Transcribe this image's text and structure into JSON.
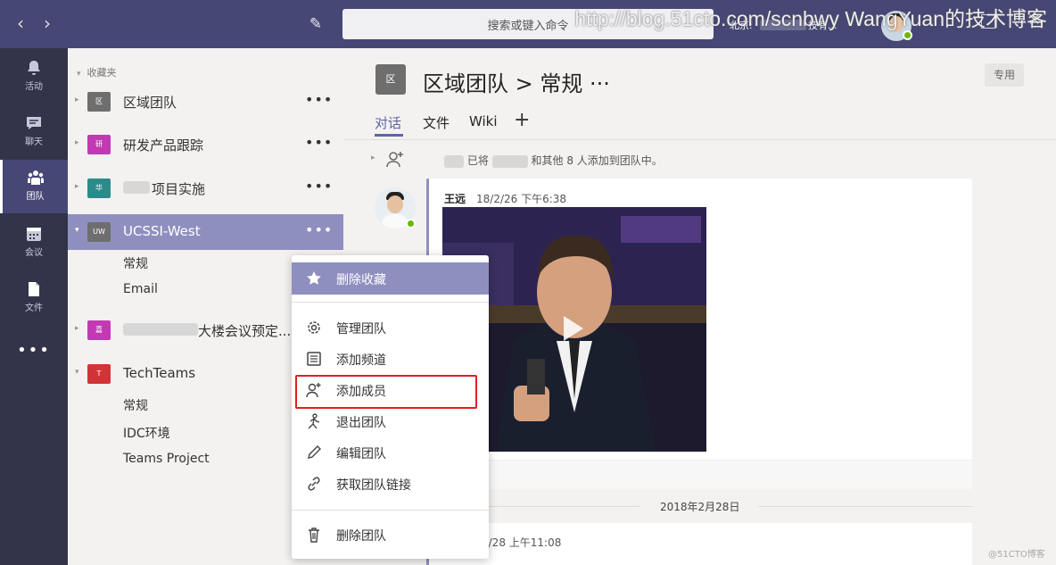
{
  "topbar": {
    "search_placeholder": "搜索或键入命令",
    "location": "北京:",
    "org": "技有...",
    "watermark": "http://blog.51cto.com/scnbwy WangYuan的技术博客"
  },
  "rail": [
    {
      "label": "活动",
      "icon": "bell-icon"
    },
    {
      "label": "聊天",
      "icon": "chat-icon"
    },
    {
      "label": "团队",
      "icon": "teams-icon",
      "active": true
    },
    {
      "label": "会议",
      "icon": "calendar-icon"
    },
    {
      "label": "文件",
      "icon": "file-icon"
    }
  ],
  "teams_panel": {
    "favorites_label": "收藏夹",
    "teams": [
      {
        "name": "区域团队",
        "avatar": "区",
        "color": "#6e6e6e"
      },
      {
        "name": "研发产品跟踪",
        "avatar": "研",
        "color": "#c239b3"
      },
      {
        "name": "项目实施",
        "avatar": "华",
        "color": "#2b8a8a"
      },
      {
        "name": "UCSSI-West",
        "avatar": "UW",
        "color": "#6e6e6e",
        "selected": true
      },
      {
        "name": "大楼会议预定...",
        "avatar": "嘉",
        "color": "#c239b3"
      },
      {
        "name": "TechTeams",
        "avatar": "T",
        "color": "#d13438"
      }
    ],
    "ucssi_channels": [
      "常规",
      "Email"
    ],
    "techteams_channels": [
      "常规",
      "IDC环境",
      "Teams Project"
    ]
  },
  "context_menu": {
    "items": [
      "删除收藏",
      "管理团队",
      "添加频道",
      "添加成员",
      "退出团队",
      "编辑团队",
      "获取团队链接",
      "删除团队"
    ]
  },
  "channel": {
    "badge": "区",
    "breadcrumb": "区域团队 > 常规 ···",
    "private_label": "专用",
    "tabs": [
      "对话",
      "文件",
      "Wiki"
    ],
    "system_message_part1": "已将",
    "system_message_part2": "和其他 8 人添加到团队中。",
    "post_author": "王远",
    "post_time": "18/2/26 下午6:38",
    "date_separator": "2018年2月28日",
    "post2_time": "2/28 上午11:08"
  },
  "corner_mark": "@51CTO博客",
  "colors": {
    "accent": "#6264a7",
    "rail": "#33344a",
    "topbar": "#464775",
    "highlight": "#e02020"
  }
}
